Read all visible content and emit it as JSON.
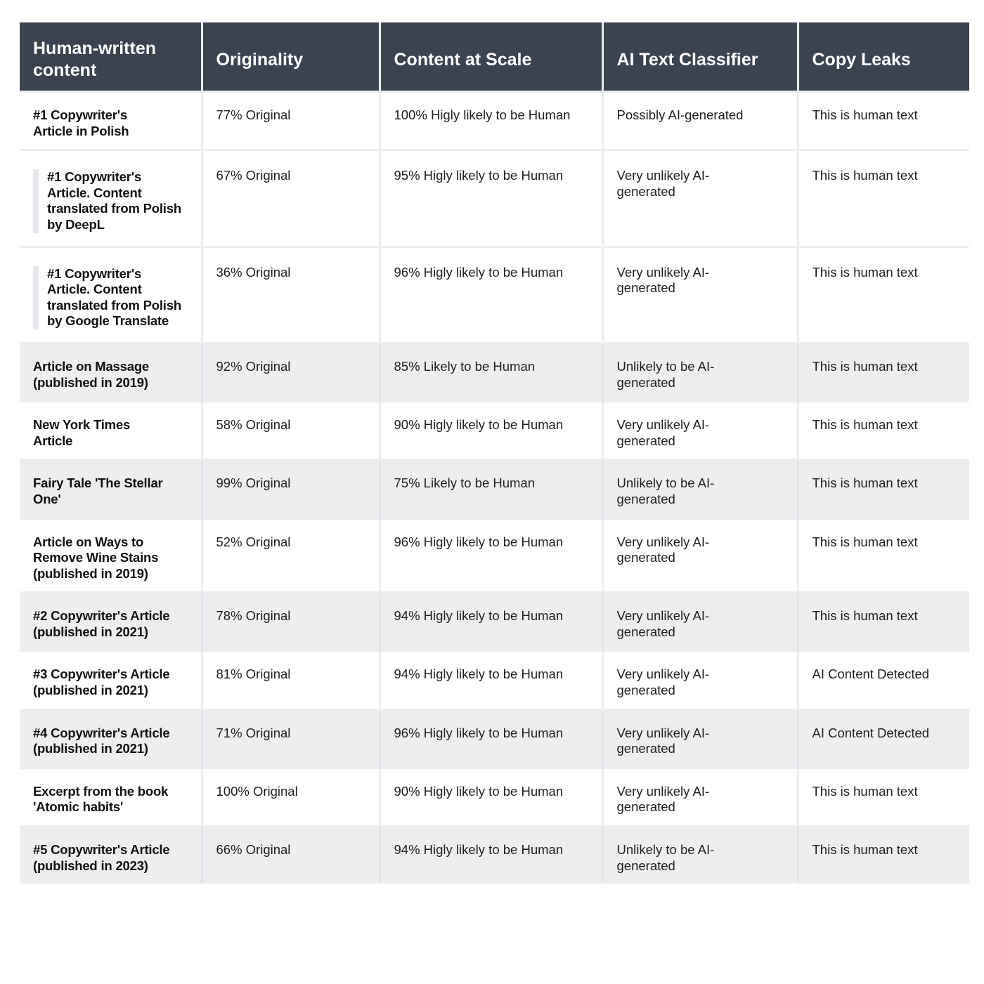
{
  "colors": {
    "header_bg": "#3b4250",
    "header_text": "#ffffff",
    "alt_row_bg": "#eceeef",
    "border": "#eceef1"
  },
  "table": {
    "headers": [
      "Human-written content",
      "Originality",
      "Content at Scale",
      "AI Text Classifier",
      "Copy Leaks"
    ],
    "rows": [
      {
        "content": "#1 Copywriter's Article in Polish",
        "originality": "77% Original",
        "content_at_scale": "100% Higly likely to be Human",
        "ai_text_classifier": "Possibly AI-generated",
        "copy_leaks": "This is human text"
      },
      {
        "content": "#1 Copywriter's Article. Content translated from Polish by DeepL",
        "originality": "67% Original",
        "content_at_scale": "95% Higly likely to be Human",
        "ai_text_classifier": "Very unlikely AI-generated",
        "copy_leaks": "This is human text"
      },
      {
        "content": "#1 Copywriter's Article. Content translated from Polish by Google Translate",
        "originality": "36% Original",
        "content_at_scale": "96% Higly likely to be Human",
        "ai_text_classifier": "Very unlikely AI-generated",
        "copy_leaks": "This is human text"
      },
      {
        "content": "Article on Massage (published in 2019)",
        "originality": "92% Original",
        "content_at_scale": "85% Likely to be Human",
        "ai_text_classifier": "Unlikely to be AI-generated",
        "copy_leaks": "This is human text"
      },
      {
        "content": "New York Times Article",
        "originality": "58% Original",
        "content_at_scale": "90% Higly likely to be Human",
        "ai_text_classifier": "Very unlikely AI-generated",
        "copy_leaks": "This is human text"
      },
      {
        "content": "Fairy Tale 'The Stellar One'",
        "originality": "99% Original",
        "content_at_scale": "75% Likely to be Human",
        "ai_text_classifier": "Unlikely to be AI-generated",
        "copy_leaks": "This is human text"
      },
      {
        "content": "Article on Ways to Remove Wine Stains (published in 2019)",
        "originality": "52% Original",
        "content_at_scale": "96% Higly likely to be Human",
        "ai_text_classifier": "Very unlikely AI-generated",
        "copy_leaks": "This is human text"
      },
      {
        "content": "#2 Copywriter's Article (published in 2021)",
        "originality": "78% Original",
        "content_at_scale": "94% Higly likely to be Human",
        "ai_text_classifier": "Very unlikely AI-generated",
        "copy_leaks": "This is human text"
      },
      {
        "content": "#3 Copywriter's Article (published in 2021)",
        "originality": "81% Original",
        "content_at_scale": "94% Higly likely to be Human",
        "ai_text_classifier": "Very unlikely AI-generated",
        "copy_leaks": "AI Content Detected"
      },
      {
        "content": "#4 Copywriter's Article (published in 2021)",
        "originality": "71% Original",
        "content_at_scale": "96% Higly likely to be Human",
        "ai_text_classifier": "Very unlikely AI-generated",
        "copy_leaks": "AI Content Detected"
      },
      {
        "content": "Excerpt from the book 'Atomic habits'",
        "originality": "100% Original",
        "content_at_scale": "90% Higly likely to be Human",
        "ai_text_classifier": "Very unlikely AI-generated",
        "copy_leaks": "This is human text"
      },
      {
        "content": "#5 Copywriter's Article (published in 2023)",
        "originality": "66% Original",
        "content_at_scale": "94% Higly likely to be Human",
        "ai_text_classifier": "Unlikely to be AI-generated",
        "copy_leaks": "This is human text"
      }
    ]
  }
}
